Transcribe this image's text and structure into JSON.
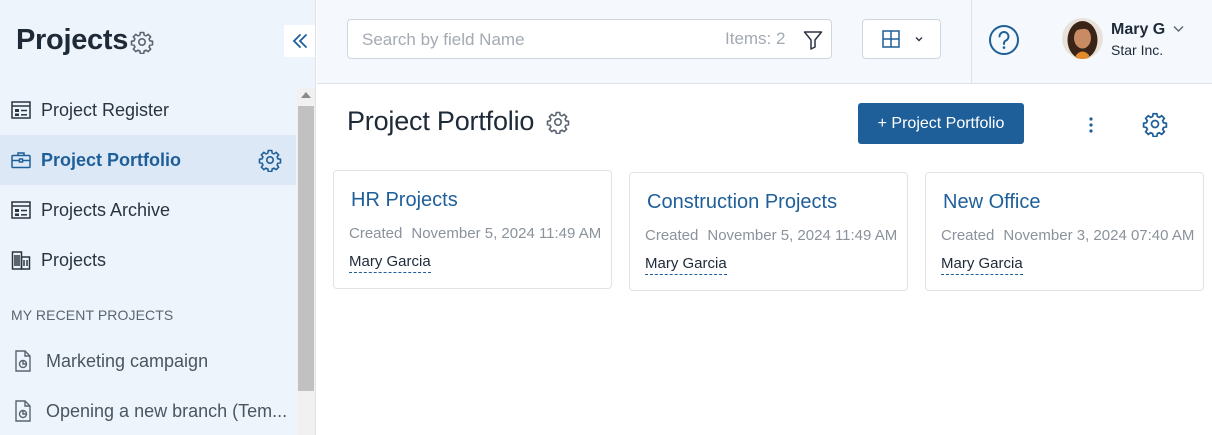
{
  "sidebar": {
    "title": "Projects",
    "items": [
      {
        "label": "Project Register",
        "icon": "register-icon",
        "active": false
      },
      {
        "label": "Project Portfolio",
        "icon": "briefcase-icon",
        "active": true
      },
      {
        "label": "Projects Archive",
        "icon": "register-icon",
        "active": false
      },
      {
        "label": "Projects",
        "icon": "buildings-icon",
        "active": false
      }
    ],
    "section_title": "MY RECENT PROJECTS",
    "recent": [
      {
        "label": "Marketing campaign",
        "icon": "project-doc-icon"
      },
      {
        "label": "Opening a new branch (Tem...",
        "icon": "project-doc-icon"
      }
    ]
  },
  "topbar": {
    "search_placeholder": "Search by field Name",
    "items_count": "Items: 2",
    "user": {
      "name": "Mary G",
      "company": "Star Inc."
    }
  },
  "main": {
    "title": "Project Portfolio",
    "add_button": "+ Project Portfolio",
    "cards": [
      {
        "title": "HR Projects",
        "created_label": "Created",
        "created": "November 5, 2024 11:49 AM",
        "owner": "Mary Garcia"
      },
      {
        "title": "Construction Projects",
        "created_label": "Created",
        "created": "November 5, 2024 11:49 AM",
        "owner": "Mary Garcia"
      },
      {
        "title": "New Office",
        "created_label": "Created",
        "created": "November 3, 2024 07:40 AM",
        "owner": "Mary Garcia"
      }
    ]
  },
  "colors": {
    "accent": "#1f5f99",
    "sidebar_bg": "#eef4fb",
    "active_item_bg": "#dce8f5",
    "text": "#1e2a38",
    "muted": "#8a929b"
  }
}
